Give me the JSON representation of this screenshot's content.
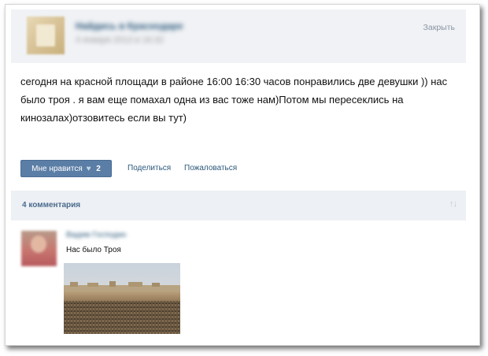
{
  "post": {
    "group_name": "Найдись в Краснодаре",
    "date": "4 января 2013 в 16:32",
    "close_label": "Закрыть",
    "text": "сегодня на красной площади в районе 16:00 16:30 часов понравились две девушки )) нас было троя . я вам еще помахал одна из вас тоже нам)Потом мы пересеклись на кинозалах)отзовитесь если вы тут)",
    "like_label": "Мне нравится",
    "like_count": "2",
    "share_label": "Поделиться",
    "report_label": "Пожаловаться"
  },
  "comments": {
    "count_label": "4 комментария",
    "sort_icon": "sort-arrows-icon",
    "items": [
      {
        "author": "Вадим Господин",
        "text": "Нас было Троя",
        "image": "troy-army-scene"
      }
    ]
  },
  "colors": {
    "link": "#2b587a",
    "like_button": "#5b7ea6",
    "header_bg": "#f0f2f5",
    "comments_bar_bg": "#edf0f4"
  }
}
